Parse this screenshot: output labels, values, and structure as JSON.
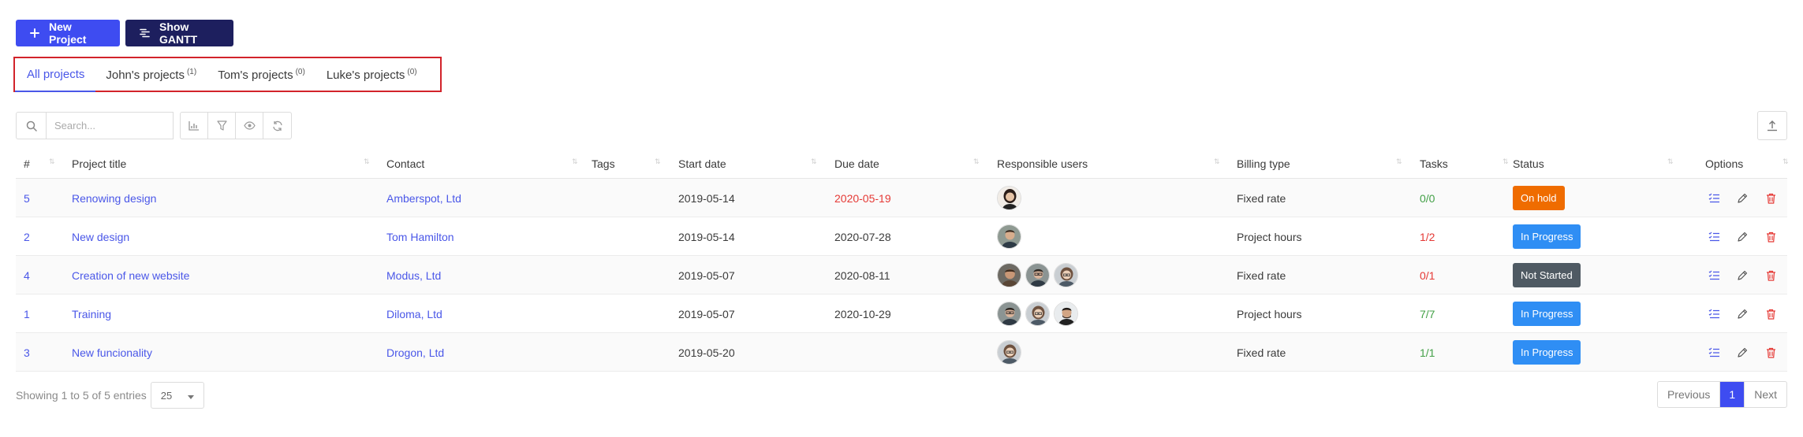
{
  "toolbar": {
    "new_project_label": "New Project",
    "show_gantt_label": "Show GANTT"
  },
  "tabs": [
    {
      "label": "All projects",
      "count": ""
    },
    {
      "label": "John's projects",
      "count": "(1)"
    },
    {
      "label": "Tom's projects",
      "count": "(0)"
    },
    {
      "label": "Luke's projects",
      "count": "(0)"
    }
  ],
  "search": {
    "placeholder": "Search..."
  },
  "table": {
    "headers": [
      "#",
      "Project title",
      "Contact",
      "Tags",
      "Start date",
      "Due date",
      "Responsible users",
      "Billing type",
      "Tasks",
      "Status",
      "Options"
    ],
    "rows": [
      {
        "id": "5",
        "title": "Renowing design",
        "contact": "Amberspot, Ltd",
        "tags": "",
        "start": "2019-05-14",
        "due": "2020-05-19",
        "billing": "Fixed rate",
        "tasks": "0/0",
        "status": "On hold"
      },
      {
        "id": "2",
        "title": "New design",
        "contact": "Tom Hamilton",
        "tags": "",
        "start": "2019-05-14",
        "due": "2020-07-28",
        "billing": "Project hours",
        "tasks": "1/2",
        "status": "In Progress"
      },
      {
        "id": "4",
        "title": "Creation of new website",
        "contact": "Modus, Ltd",
        "tags": "",
        "start": "2019-05-07",
        "due": "2020-08-11",
        "billing": "Fixed rate",
        "tasks": "0/1",
        "status": "Not Started"
      },
      {
        "id": "1",
        "title": "Training",
        "contact": "Diloma, Ltd",
        "tags": "",
        "start": "2019-05-07",
        "due": "2020-10-29",
        "billing": "Project hours",
        "tasks": "7/7",
        "status": "In Progress"
      },
      {
        "id": "3",
        "title": "New funcionality",
        "contact": "Drogon, Ltd",
        "tags": "",
        "start": "2019-05-20",
        "due": "",
        "billing": "Fixed rate",
        "tasks": "1/1",
        "status": "In Progress"
      }
    ]
  },
  "footer": {
    "entries_text": "Showing 1 to 5 of 5 entries",
    "page_size": "25",
    "previous_label": "Previous",
    "current_page": "1",
    "next_label": "Next"
  },
  "colors": {
    "accent": "#3e4cf1",
    "gantt": "#1d1f5e",
    "on_hold": "#ef6c00",
    "in_progress": "#2f8ef4",
    "not_started": "#4f5a63",
    "overdue": "#e53935",
    "tab_highlight_border": "#d2232a"
  },
  "icons": {
    "new_project": "plus-icon",
    "gantt": "gantt-icon",
    "search": "search-icon",
    "chart": "chart-icon",
    "filter": "filter-icon",
    "visibility": "eye-icon",
    "reload": "refresh-icon",
    "export": "upload-icon",
    "tasks_option": "task-list-icon",
    "edit_option": "pencil-icon",
    "delete_option": "trash-icon"
  }
}
